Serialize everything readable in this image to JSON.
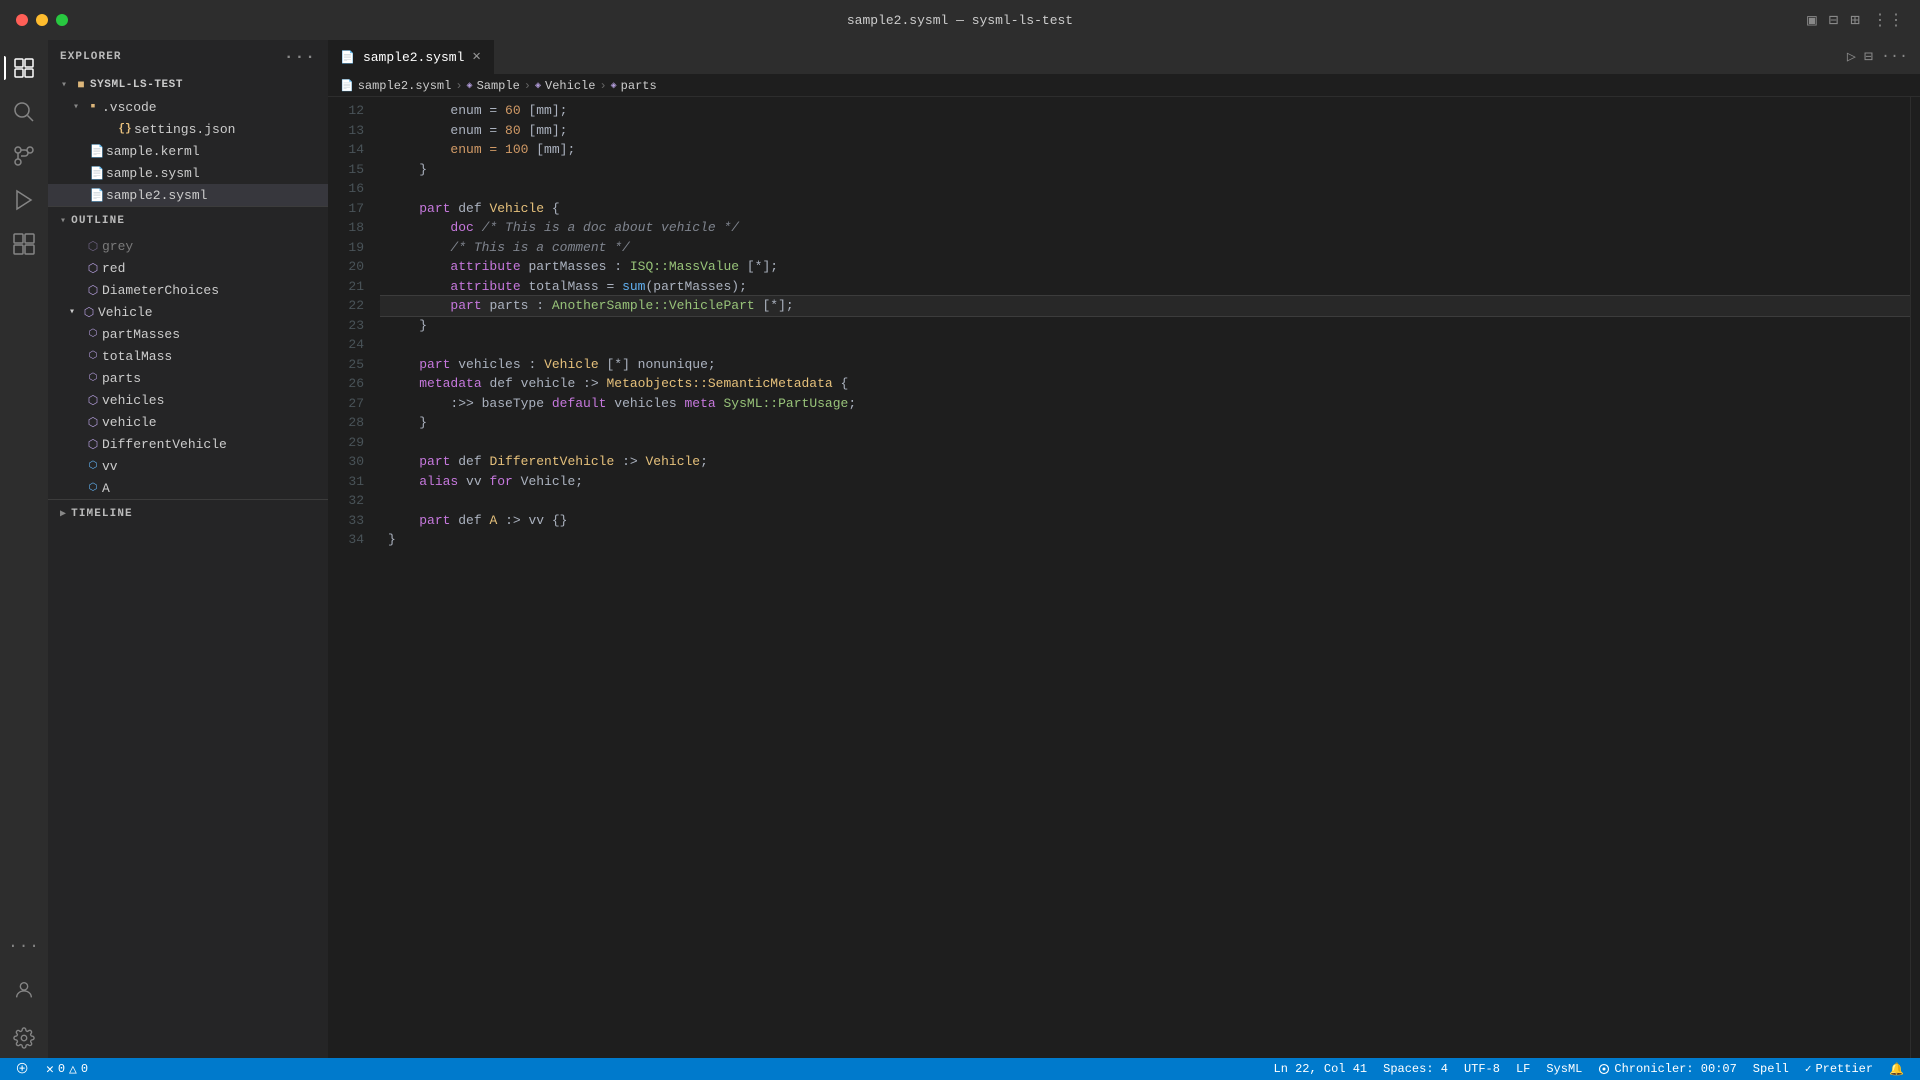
{
  "titleBar": {
    "title": "sample2.sysml — sysml-ls-test"
  },
  "activityBar": {
    "items": [
      {
        "name": "explorer",
        "icon": "⬚",
        "active": true
      },
      {
        "name": "search",
        "icon": "🔍",
        "active": false
      },
      {
        "name": "source-control",
        "icon": "⑂",
        "active": false
      },
      {
        "name": "run",
        "icon": "▷",
        "active": false
      },
      {
        "name": "extensions",
        "icon": "⊞",
        "active": false
      },
      {
        "name": "more",
        "icon": "···",
        "active": false
      }
    ],
    "bottomItems": [
      {
        "name": "accounts",
        "icon": "👤"
      },
      {
        "name": "settings",
        "icon": "⚙"
      }
    ]
  },
  "sidebar": {
    "explorerTitle": "EXPLORER",
    "moreLabel": "···",
    "rootFolder": "SYSML-LS-TEST",
    "fileTree": [
      {
        "id": "vscode",
        "label": ".vscode",
        "type": "folder",
        "indent": 1,
        "expanded": true
      },
      {
        "id": "settings",
        "label": "settings.json",
        "type": "json",
        "indent": 2
      },
      {
        "id": "sample-kerml",
        "label": "sample.kerml",
        "type": "kerml",
        "indent": 1
      },
      {
        "id": "sample-sysml",
        "label": "sample.sysml",
        "type": "sysml",
        "indent": 1
      },
      {
        "id": "sample2-sysml",
        "label": "sample2.sysml",
        "type": "sysml2",
        "indent": 1,
        "selected": true
      }
    ],
    "outlineTitle": "OUTLINE",
    "outlineItems": [
      {
        "id": "grey",
        "label": "grey",
        "type": "cube-small",
        "indent": 2,
        "show": false
      },
      {
        "id": "red",
        "label": "red",
        "type": "cube-small",
        "indent": 2
      },
      {
        "id": "DiameterChoices",
        "label": "DiameterChoices",
        "type": "cube",
        "indent": 1
      },
      {
        "id": "Vehicle",
        "label": "Vehicle",
        "type": "cube",
        "indent": 1,
        "expanded": true
      },
      {
        "id": "partMasses",
        "label": "partMasses",
        "type": "cube-small",
        "indent": 2
      },
      {
        "id": "totalMass",
        "label": "totalMass",
        "type": "cube-small",
        "indent": 2
      },
      {
        "id": "parts",
        "label": "parts",
        "type": "cube-small",
        "indent": 2
      },
      {
        "id": "vehicles",
        "label": "vehicles",
        "type": "cube",
        "indent": 1
      },
      {
        "id": "vehicle",
        "label": "vehicle",
        "type": "cube",
        "indent": 1
      },
      {
        "id": "DifferentVehicle",
        "label": "DifferentVehicle",
        "type": "cube",
        "indent": 1
      },
      {
        "id": "vv",
        "label": "vv",
        "type": "cube-small",
        "indent": 1
      },
      {
        "id": "A",
        "label": "A",
        "type": "cube-small",
        "indent": 1
      }
    ],
    "timelineTitle": "TIMELINE"
  },
  "tabs": [
    {
      "label": "sample2.sysml",
      "active": true,
      "icon": "📄"
    }
  ],
  "breadcrumb": [
    {
      "label": "sample2.sysml",
      "icon": "📄"
    },
    {
      "label": "Sample",
      "icon": "◈"
    },
    {
      "label": "Vehicle",
      "icon": "◈"
    },
    {
      "label": "parts",
      "icon": "◈"
    }
  ],
  "codeLines": [
    {
      "num": 12,
      "tokens": [
        {
          "text": "        enum = ",
          "class": "plain"
        },
        {
          "text": "60",
          "class": "num"
        },
        {
          "text": " [mm];",
          "class": "plain"
        }
      ]
    },
    {
      "num": 13,
      "tokens": [
        {
          "text": "        enum = ",
          "class": "plain"
        },
        {
          "text": "80",
          "class": "num"
        },
        {
          "text": " [mm];",
          "class": "plain"
        }
      ]
    },
    {
      "num": 14,
      "tokens": [
        {
          "text": "        enum = ",
          "class": "num"
        },
        {
          "text": "100",
          "class": "num"
        },
        {
          "text": " [mm];",
          "class": "plain"
        }
      ]
    },
    {
      "num": 15,
      "tokens": [
        {
          "text": "    }",
          "class": "plain"
        }
      ]
    },
    {
      "num": 16,
      "tokens": []
    },
    {
      "num": 17,
      "tokens": [
        {
          "text": "    ",
          "class": "plain"
        },
        {
          "text": "part",
          "class": "kw"
        },
        {
          "text": " def ",
          "class": "plain"
        },
        {
          "text": "Vehicle",
          "class": "type"
        },
        {
          "text": " {",
          "class": "plain"
        }
      ]
    },
    {
      "num": 18,
      "tokens": [
        {
          "text": "        ",
          "class": "plain"
        },
        {
          "text": "doc",
          "class": "meta-kw"
        },
        {
          "text": " /* This is a doc about vehicle */",
          "class": "comment"
        }
      ]
    },
    {
      "num": 19,
      "tokens": [
        {
          "text": "        ",
          "class": "plain"
        },
        {
          "text": "/* This is a comment */",
          "class": "comment"
        }
      ]
    },
    {
      "num": 20,
      "tokens": [
        {
          "text": "        ",
          "class": "plain"
        },
        {
          "text": "attribute",
          "class": "kw"
        },
        {
          "text": " partMasses : ",
          "class": "plain"
        },
        {
          "text": "ISQ::MassValue",
          "class": "green"
        },
        {
          "text": " [*];",
          "class": "plain"
        }
      ]
    },
    {
      "num": 21,
      "tokens": [
        {
          "text": "        ",
          "class": "plain"
        },
        {
          "text": "attribute",
          "class": "kw"
        },
        {
          "text": " totalMass = ",
          "class": "plain"
        },
        {
          "text": "sum",
          "class": "fn"
        },
        {
          "text": "(partMasses);",
          "class": "plain"
        }
      ]
    },
    {
      "num": 22,
      "tokens": [
        {
          "text": "        ",
          "class": "plain"
        },
        {
          "text": "part",
          "class": "kw"
        },
        {
          "text": " parts : ",
          "class": "plain"
        },
        {
          "text": "AnotherSample::VehiclePart",
          "class": "green"
        },
        {
          "text": " [*];",
          "class": "plain"
        }
      ],
      "current": true
    },
    {
      "num": 23,
      "tokens": [
        {
          "text": "    }",
          "class": "plain"
        }
      ]
    },
    {
      "num": 24,
      "tokens": []
    },
    {
      "num": 25,
      "tokens": [
        {
          "text": "    ",
          "class": "plain"
        },
        {
          "text": "part",
          "class": "kw"
        },
        {
          "text": " vehicles : ",
          "class": "plain"
        },
        {
          "text": "Vehicle",
          "class": "type"
        },
        {
          "text": " [*] nonunique;",
          "class": "plain"
        }
      ]
    },
    {
      "num": 26,
      "tokens": [
        {
          "text": "    ",
          "class": "plain"
        },
        {
          "text": "metadata",
          "class": "meta-kw"
        },
        {
          "text": " def vehicle :> ",
          "class": "plain"
        },
        {
          "text": "Metaobjects::SemanticMetadata",
          "class": "type"
        },
        {
          "text": " {",
          "class": "plain"
        }
      ]
    },
    {
      "num": 27,
      "tokens": [
        {
          "text": "        ",
          "class": "plain"
        },
        {
          "text": ":>> baseType",
          "class": "plain"
        },
        {
          "text": " default",
          "class": "kw"
        },
        {
          "text": " vehicles",
          "class": "plain"
        },
        {
          "text": " meta ",
          "class": "kw"
        },
        {
          "text": "SysML::PartUsage",
          "class": "green"
        },
        {
          "text": ";",
          "class": "plain"
        }
      ]
    },
    {
      "num": 28,
      "tokens": [
        {
          "text": "    }",
          "class": "plain"
        }
      ]
    },
    {
      "num": 29,
      "tokens": []
    },
    {
      "num": 30,
      "tokens": [
        {
          "text": "    ",
          "class": "plain"
        },
        {
          "text": "part",
          "class": "kw"
        },
        {
          "text": " def ",
          "class": "plain"
        },
        {
          "text": "DifferentVehicle",
          "class": "type"
        },
        {
          "text": " :> ",
          "class": "plain"
        },
        {
          "text": "Vehicle",
          "class": "type"
        },
        {
          "text": ";",
          "class": "plain"
        }
      ]
    },
    {
      "num": 31,
      "tokens": [
        {
          "text": "    ",
          "class": "plain"
        },
        {
          "text": "alias",
          "class": "kw"
        },
        {
          "text": " vv ",
          "class": "plain"
        },
        {
          "text": "for",
          "class": "kw"
        },
        {
          "text": " Vehicle;",
          "class": "plain"
        }
      ]
    },
    {
      "num": 32,
      "tokens": []
    },
    {
      "num": 33,
      "tokens": [
        {
          "text": "    ",
          "class": "plain"
        },
        {
          "text": "part",
          "class": "kw"
        },
        {
          "text": " def ",
          "class": "plain"
        },
        {
          "text": "A",
          "class": "type"
        },
        {
          "text": " :> vv {}",
          "class": "plain"
        }
      ]
    },
    {
      "num": 34,
      "tokens": [
        {
          "text": "}",
          "class": "plain"
        }
      ]
    }
  ],
  "statusBar": {
    "leftItems": [
      {
        "label": "⎇",
        "text": ""
      },
      {
        "label": "0",
        "icon": "✗",
        "class": "error"
      },
      {
        "label": "0",
        "icon": "△",
        "class": "warn"
      }
    ],
    "centerItems": [
      {
        "text": "Ln 22, Col 41"
      },
      {
        "text": "Spaces: 4"
      },
      {
        "text": "UTF-8"
      },
      {
        "text": "LF"
      },
      {
        "text": "SysML"
      }
    ],
    "rightItems": [
      {
        "text": "Chronicler: 00:07"
      },
      {
        "text": "Spell"
      },
      {
        "text": "Prettier"
      },
      {
        "icon": "🔔"
      }
    ]
  }
}
